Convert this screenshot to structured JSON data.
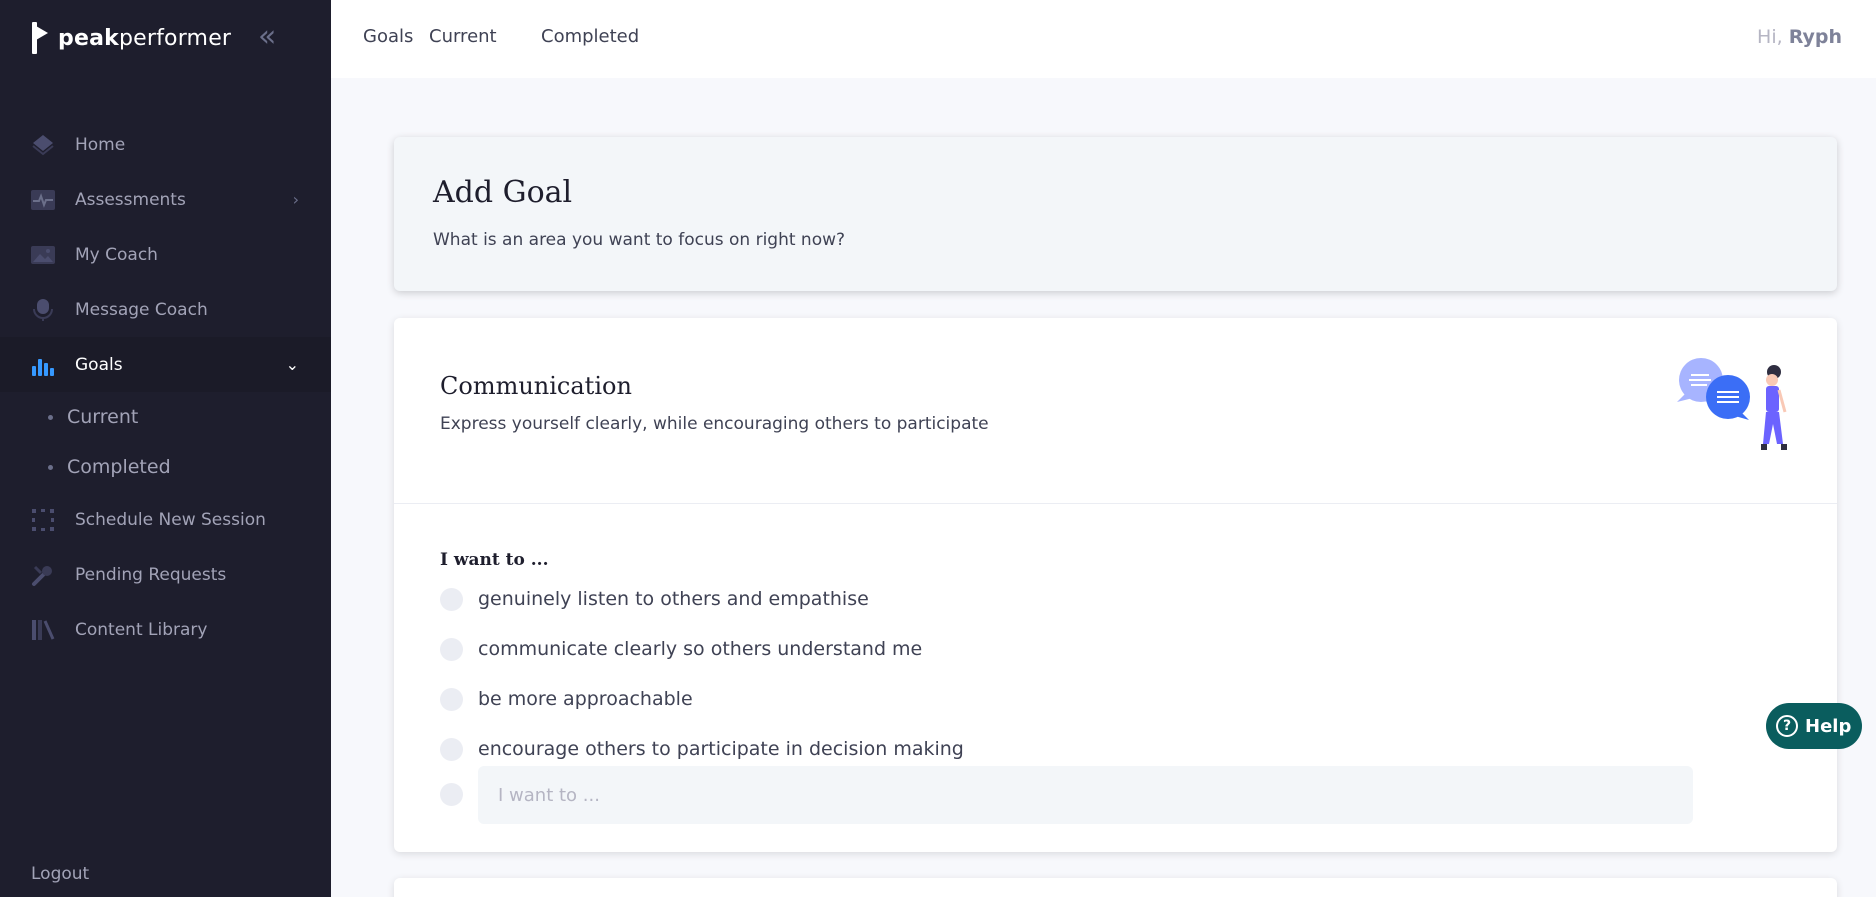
{
  "brand": {
    "name_bold": "peak",
    "name_rest": "performer"
  },
  "sidebar": {
    "items": [
      {
        "label": "Home",
        "icon": "home-icon"
      },
      {
        "label": "Assessments",
        "icon": "pulse-icon"
      },
      {
        "label": "My Coach",
        "icon": "image-icon"
      },
      {
        "label": "Message Coach",
        "icon": "microphone-icon"
      },
      {
        "label": "Goals",
        "icon": "bar-chart-icon"
      },
      {
        "label": "Schedule New Session",
        "icon": "select-frame-icon"
      },
      {
        "label": "Pending Requests",
        "icon": "tools-icon"
      },
      {
        "label": "Content Library",
        "icon": "library-icon"
      }
    ],
    "goals_sub": [
      {
        "label": "Current"
      },
      {
        "label": "Completed"
      }
    ],
    "logout": "Logout"
  },
  "header": {
    "tabs": [
      {
        "label": "Goals"
      },
      {
        "label": "Current"
      },
      {
        "label": "Completed"
      }
    ],
    "greeting_prefix": "Hi,",
    "user_name": "Ryph"
  },
  "add_goal": {
    "title": "Add Goal",
    "subtitle": "What is an area you want to focus on right now?"
  },
  "topic": {
    "title": "Communication",
    "description": "Express yourself clearly, while encouraging others to participate",
    "prompt": "I want to ...",
    "options": [
      {
        "label": "genuinely listen to others and empathise"
      },
      {
        "label": "communicate clearly so others understand me"
      },
      {
        "label": "be more approachable"
      },
      {
        "label": "encourage others to participate in decision making"
      }
    ],
    "custom_placeholder": "I want to ..."
  },
  "help": {
    "label": "Help"
  },
  "colors": {
    "sidebar_bg": "#1e1e2d",
    "accent_blue": "#3699ff",
    "help_bg": "#0a5d5e",
    "illustration_purple": "#6c63ff"
  }
}
